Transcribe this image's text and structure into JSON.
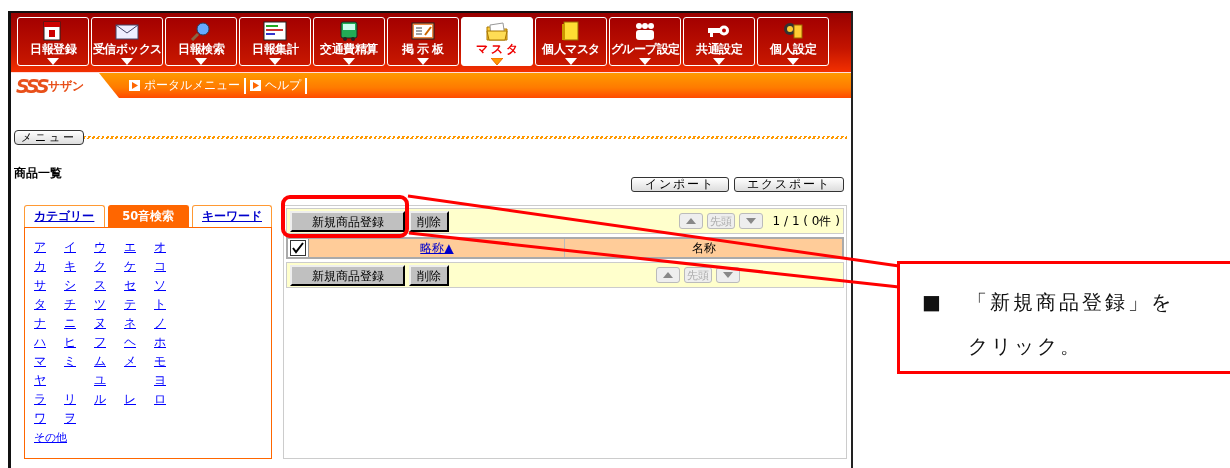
{
  "nav": [
    {
      "label": "日報登録",
      "selected": false
    },
    {
      "label": "受信ボックス",
      "selected": false
    },
    {
      "label": "日報検索",
      "selected": false
    },
    {
      "label": "日報集計",
      "selected": false
    },
    {
      "label": "交通費精算",
      "selected": false
    },
    {
      "label": "掲 示 板",
      "selected": false
    },
    {
      "label": "マ ス タ",
      "selected": true
    },
    {
      "label": "個人マスタ",
      "selected": false
    },
    {
      "label": "グループ設定",
      "selected": false
    },
    {
      "label": "共通設定",
      "selected": false
    },
    {
      "label": "個人設定",
      "selected": false
    }
  ],
  "logo": {
    "mark": "SSS",
    "sub": "サザン"
  },
  "links": [
    "ポータルメニュー",
    "ヘルプ"
  ],
  "menu_button": "メニュー",
  "page_title": "商品一覧",
  "actions": [
    "インポート",
    "エクスポート"
  ],
  "search_tabs": [
    {
      "label": "カテゴリー",
      "selected": false
    },
    {
      "label": "50音検索",
      "selected": true
    },
    {
      "label": "キーワード",
      "selected": false
    }
  ],
  "kana_rows": [
    [
      "ア",
      "イ",
      "ウ",
      "エ",
      "オ"
    ],
    [
      "カ",
      "キ",
      "ク",
      "ケ",
      "コ"
    ],
    [
      "サ",
      "シ",
      "ス",
      "セ",
      "ソ"
    ],
    [
      "タ",
      "チ",
      "ツ",
      "テ",
      "ト"
    ],
    [
      "ナ",
      "ニ",
      "ヌ",
      "ネ",
      "ノ"
    ],
    [
      "ハ",
      "ヒ",
      "フ",
      "ヘ",
      "ホ"
    ],
    [
      "マ",
      "ミ",
      "ム",
      "メ",
      "モ"
    ],
    [
      "ヤ",
      null,
      "ユ",
      null,
      "ヨ"
    ],
    [
      "ラ",
      "リ",
      "ル",
      "レ",
      "ロ"
    ],
    [
      "ワ",
      "ヲ"
    ]
  ],
  "kana_other": "その他",
  "list": {
    "top_toolbar": {
      "buttons": [
        "新規商品登録",
        "削除"
      ],
      "first_button": {
        "label": "先頭",
        "disabled": true
      },
      "count": "1 / 1 ( 0件 )"
    },
    "select_all": {
      "checked": true
    },
    "columns": [
      {
        "label": "略称▲",
        "sortable": true
      },
      {
        "label": "名称",
        "sortable": false
      }
    ],
    "bottom_toolbar": {
      "buttons": [
        "新規商品登録",
        "削除"
      ],
      "first_button": {
        "label": "先頭",
        "disabled": true
      }
    }
  },
  "callout": {
    "text": "■　「新規商品登録」をクリック。"
  }
}
